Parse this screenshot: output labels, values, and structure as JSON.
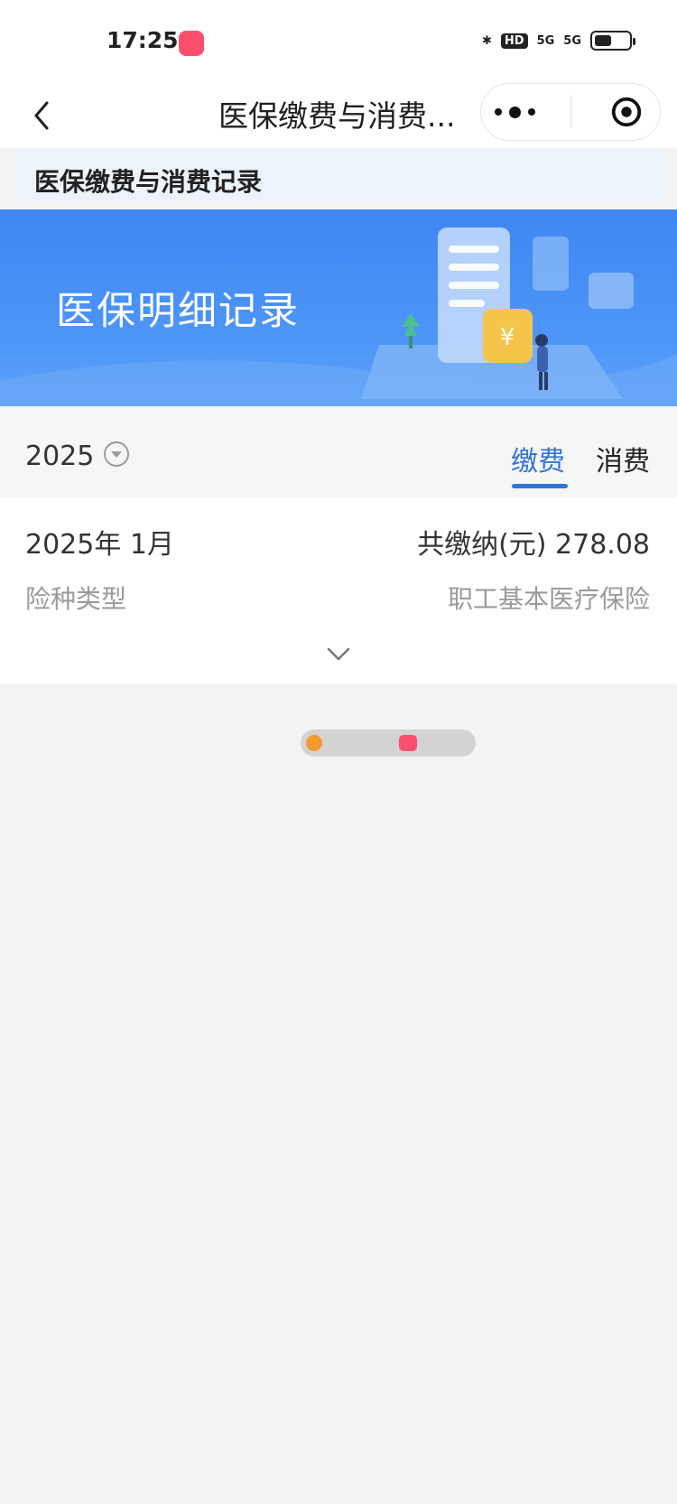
{
  "status_bar": {
    "time": "17:25",
    "hd_label": "HD",
    "net1": "5G",
    "net2": "5G"
  },
  "nav": {
    "title": "医保缴费与消费..."
  },
  "section": {
    "title": "医保缴费与消费记录"
  },
  "banner": {
    "title": "医保明细记录"
  },
  "filters": {
    "year": "2025",
    "tabs": [
      {
        "label": "缴费",
        "active": true
      },
      {
        "label": "消费",
        "active": false
      }
    ]
  },
  "record": {
    "date": "2025年 1月",
    "total_text": "共缴纳(元) 278.08",
    "type_label": "险种类型",
    "type_value": "职工基本医疗保险"
  },
  "colors": {
    "accent": "#2f74d6",
    "banner_blue": "#4e97f7",
    "background": "#f3f3f3"
  },
  "icons": {
    "back": "chevron-left-icon",
    "more": "more-dots-icon",
    "target": "target-icon",
    "dropdown": "dropdown-circle-icon",
    "expand": "chevron-down-icon"
  }
}
